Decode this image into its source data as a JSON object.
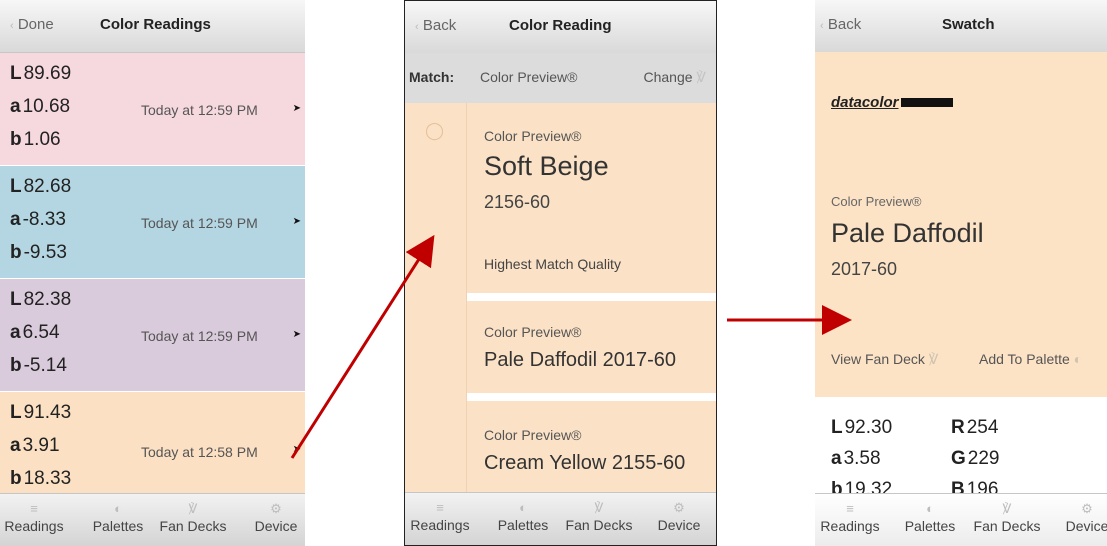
{
  "screen1": {
    "header": {
      "back": "Done",
      "title": "Color Readings"
    },
    "readings": [
      {
        "L": "89.69",
        "a": "10.68",
        "b": "1.06",
        "time": "Today at 12:59 PM",
        "color": "#f6d9df"
      },
      {
        "L": "82.68",
        "a": "-8.33",
        "b": "-9.53",
        "time": "Today at 12:59 PM",
        "color": "#b4d6e2"
      },
      {
        "L": "82.38",
        "a": "6.54",
        "b": "-5.14",
        "time": "Today at 12:59 PM",
        "color": "#dacbdc"
      },
      {
        "L": "91.43",
        "a": "3.91",
        "b": "18.33",
        "time": "Today at 12:58 PM",
        "color": "#fbe0c3"
      }
    ]
  },
  "screen2": {
    "header": {
      "back": "Back",
      "title": "Color Reading"
    },
    "match_bar": {
      "label": "Match:",
      "brand": "Color Preview®",
      "change": "Change"
    },
    "top_match": {
      "brand": "Color Preview®",
      "name": "Soft Beige",
      "code": "2156-60",
      "quality": "Highest Match Quality"
    },
    "matches": [
      {
        "brand": "Color Preview®",
        "name": "Pale Daffodil 2017-60"
      },
      {
        "brand": "Color Preview®",
        "name": "Cream Yellow 2155-60"
      }
    ]
  },
  "screen3": {
    "header": {
      "back": "Back",
      "title": "Swatch"
    },
    "logo": "datacolor",
    "brand": "Color Preview®",
    "name": "Pale Daffodil",
    "code": "2017-60",
    "actions": {
      "fan_deck": "View Fan Deck",
      "palette": "Add To Palette"
    },
    "values": {
      "L": "92.30",
      "a": "3.58",
      "b": "19.32",
      "R": "254",
      "G": "229",
      "B": "196"
    }
  },
  "labels": {
    "L": "L",
    "a": "a",
    "b": "b",
    "R": "R",
    "G": "G",
    "B": "B"
  },
  "tabs": [
    "Readings",
    "Palettes",
    "Fan Decks",
    "Device"
  ],
  "colors": {
    "arrow": "#c00000",
    "swatch": "#fde3c6"
  }
}
